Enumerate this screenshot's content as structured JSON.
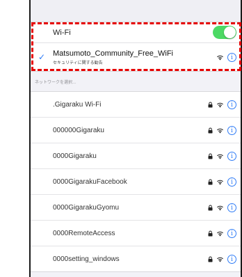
{
  "wifi_toggle": {
    "label": "Wi-Fi",
    "enabled": true,
    "on_color": "#4cd964"
  },
  "connected_network": {
    "name": "Matsumoto_Community_Free_WiFi",
    "subtitle": "セキュリティに関する勧告",
    "check_icon": "checkmark-icon",
    "accent": "#2f7cf6"
  },
  "section_header": "ネットワークを選択...",
  "networks": [
    {
      "name": ".Gigaraku Wi-Fi",
      "locked": true
    },
    {
      "name": "000000Gigaraku",
      "locked": true
    },
    {
      "name": "0000Gigaraku",
      "locked": true
    },
    {
      "name": "0000GigarakuFacebook",
      "locked": true
    },
    {
      "name": "0000GigarakuGyomu",
      "locked": true
    },
    {
      "name": "0000RemoteAccess",
      "locked": true
    },
    {
      "name": "0000setting_windows",
      "locked": true
    }
  ],
  "highlight_color": "#e60000"
}
